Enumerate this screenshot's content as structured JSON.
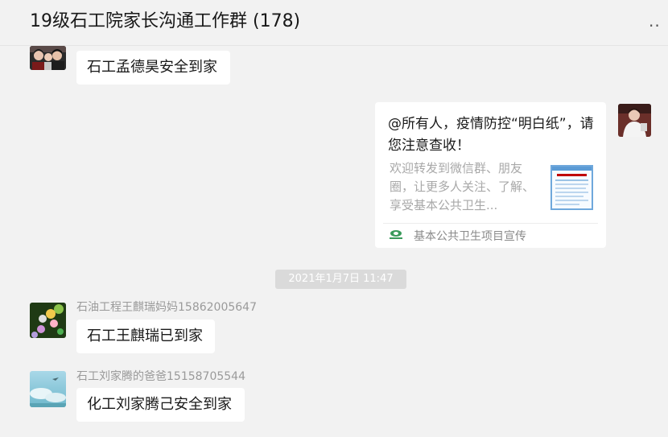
{
  "header": {
    "title": "19级石工院家长沟通工作群 (178)",
    "more_icon": "more-dots-icon",
    "more_glyph": ".."
  },
  "messages": [
    {
      "id": "m1",
      "side": "left",
      "sender": "",
      "text": "石工孟德昊安全到家",
      "avatar": "family-photo-avatar"
    },
    {
      "id": "m2",
      "side": "right",
      "type": "link-card",
      "card": {
        "title": "@所有人，疫情防控“明白纸”，请您注意查收！",
        "description": "欢迎转发到微信群、朋友圈，让更多人关注、了解、享受基本公共卫生...",
        "source": "基本公共卫生项目宣传",
        "source_icon": "public-health-logo-icon",
        "thumbnail": "document-thumbnail"
      },
      "avatar": "person-white-shirt-avatar"
    },
    {
      "id": "m3",
      "side": "left",
      "sender": "石油工程王麒瑞妈妈15862005647",
      "text": "石工王麒瑞已到家",
      "avatar": "colorful-beads-avatar"
    },
    {
      "id": "m4",
      "side": "left",
      "sender": "石工刘家腾的爸爸15158705544",
      "text": "化工刘家腾己安全到家",
      "avatar": "sky-landscape-avatar"
    }
  ],
  "timestamp": "2021年1月7日 11:47",
  "colors": {
    "background": "#f2f2f2",
    "bubble": "#ffffff",
    "text": "#191919",
    "sender": "#9a9a9a",
    "timestamp_bg": "#dadada"
  }
}
